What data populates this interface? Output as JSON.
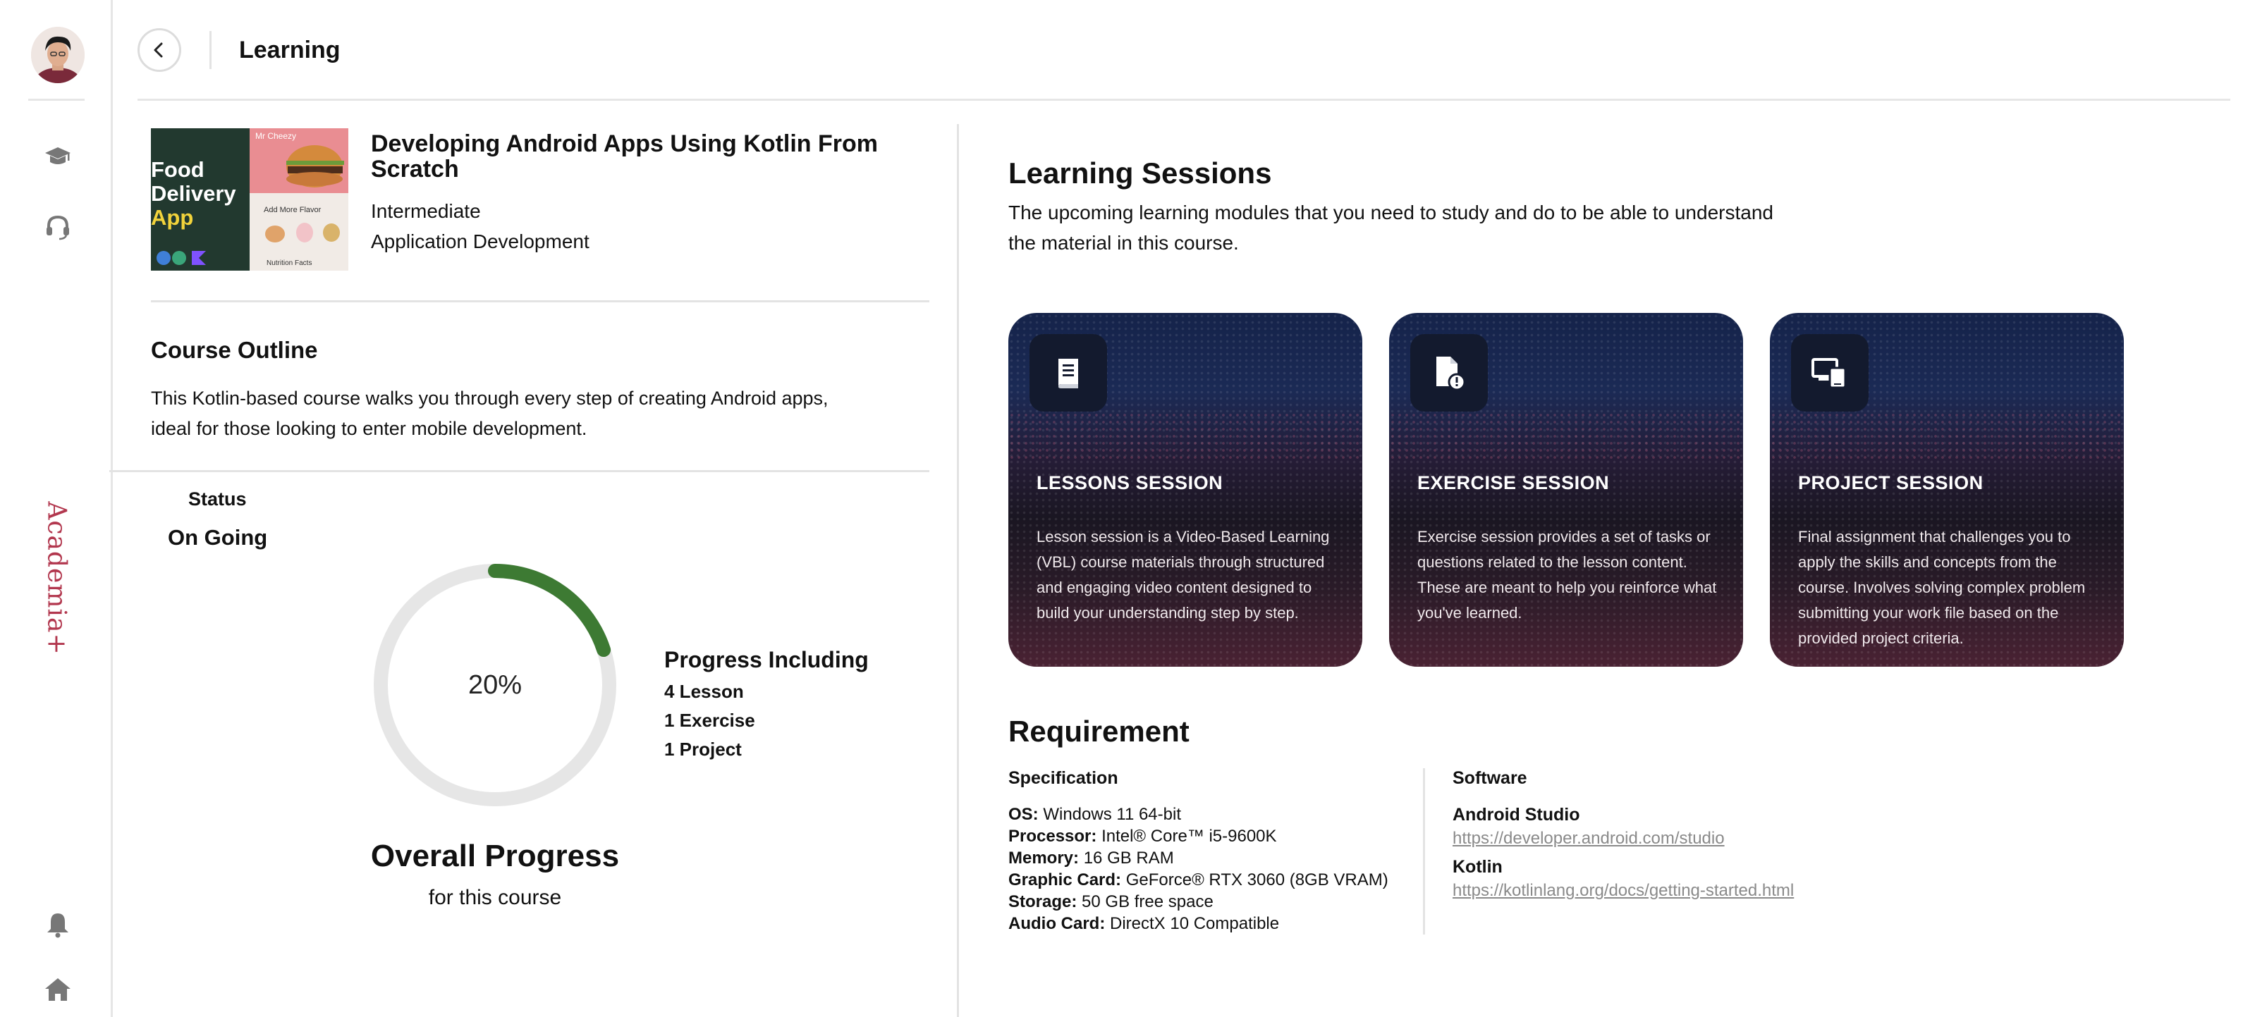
{
  "app": {
    "brand": "Academia+"
  },
  "header": {
    "title": "Learning"
  },
  "course": {
    "thumbnail": {
      "headline_line1": "Food",
      "headline_line2": "Delivery",
      "headline_line3": "App",
      "brand_label": "Mr Cheezy",
      "add_more_label": "Add More Flavor",
      "nutrition_label": "Nutrition Facts"
    },
    "title": "Developing Android Apps Using Kotlin From Scratch",
    "level": "Intermediate",
    "category": "Application Development"
  },
  "outline": {
    "title": "Course Outline",
    "text": "This Kotlin-based course walks you through every step of creating Android apps, ideal for those looking to enter mobile development."
  },
  "status": {
    "label": "Status",
    "value": "On Going"
  },
  "progress": {
    "percent_label": "20%",
    "percent_value": 0.2,
    "colors": {
      "fill": "#3d7a33",
      "track": "#e6e6e6"
    },
    "including_title": "Progress Including",
    "items": [
      "4 Lesson",
      "1 Exercise",
      "1 Project"
    ],
    "overall_title": "Overall Progress",
    "overall_sub": "for this course"
  },
  "sessions": {
    "title": "Learning Sessions",
    "description": "The upcoming learning modules that you need to study and do to be able to understand the material in this course.",
    "cards": [
      {
        "icon": "book-icon",
        "title": "LESSONS SESSION",
        "text": "Lesson session is a Video-Based Learning (VBL) course materials through structured and engaging video content designed to build your understanding step by step."
      },
      {
        "icon": "document-alert-icon",
        "title": "EXERCISE SESSION",
        "text": "Exercise session provides a set of tasks or questions related to the lesson content. These are meant to help you reinforce what you've learned."
      },
      {
        "icon": "devices-icon",
        "title": "PROJECT SESSION",
        "text": "Final assignment that challenges you to apply the skills and concepts from the course. Involves solving complex problem submitting your work file based on the provided project criteria."
      }
    ]
  },
  "requirement": {
    "title": "Requirement",
    "specification": {
      "title": "Specification",
      "items": [
        {
          "key": "OS:",
          "value": "Windows 11 64-bit"
        },
        {
          "key": "Processor:",
          "value": "Intel® Core™ i5-9600K"
        },
        {
          "key": "Memory:",
          "value": "16 GB RAM"
        },
        {
          "key": "Graphic Card:",
          "value": "GeForce® RTX 3060 (8GB VRAM)"
        },
        {
          "key": "Storage:",
          "value": "50 GB free space"
        },
        {
          "key": "Audio Card:",
          "value": "DirectX 10 Compatible"
        }
      ]
    },
    "software": {
      "title": "Software",
      "items": [
        {
          "name": "Android Studio",
          "url": "https://developer.android.com/studio"
        },
        {
          "name": "Kotlin",
          "url": "https://kotlinlang.org/docs/getting-started.html"
        }
      ]
    }
  }
}
